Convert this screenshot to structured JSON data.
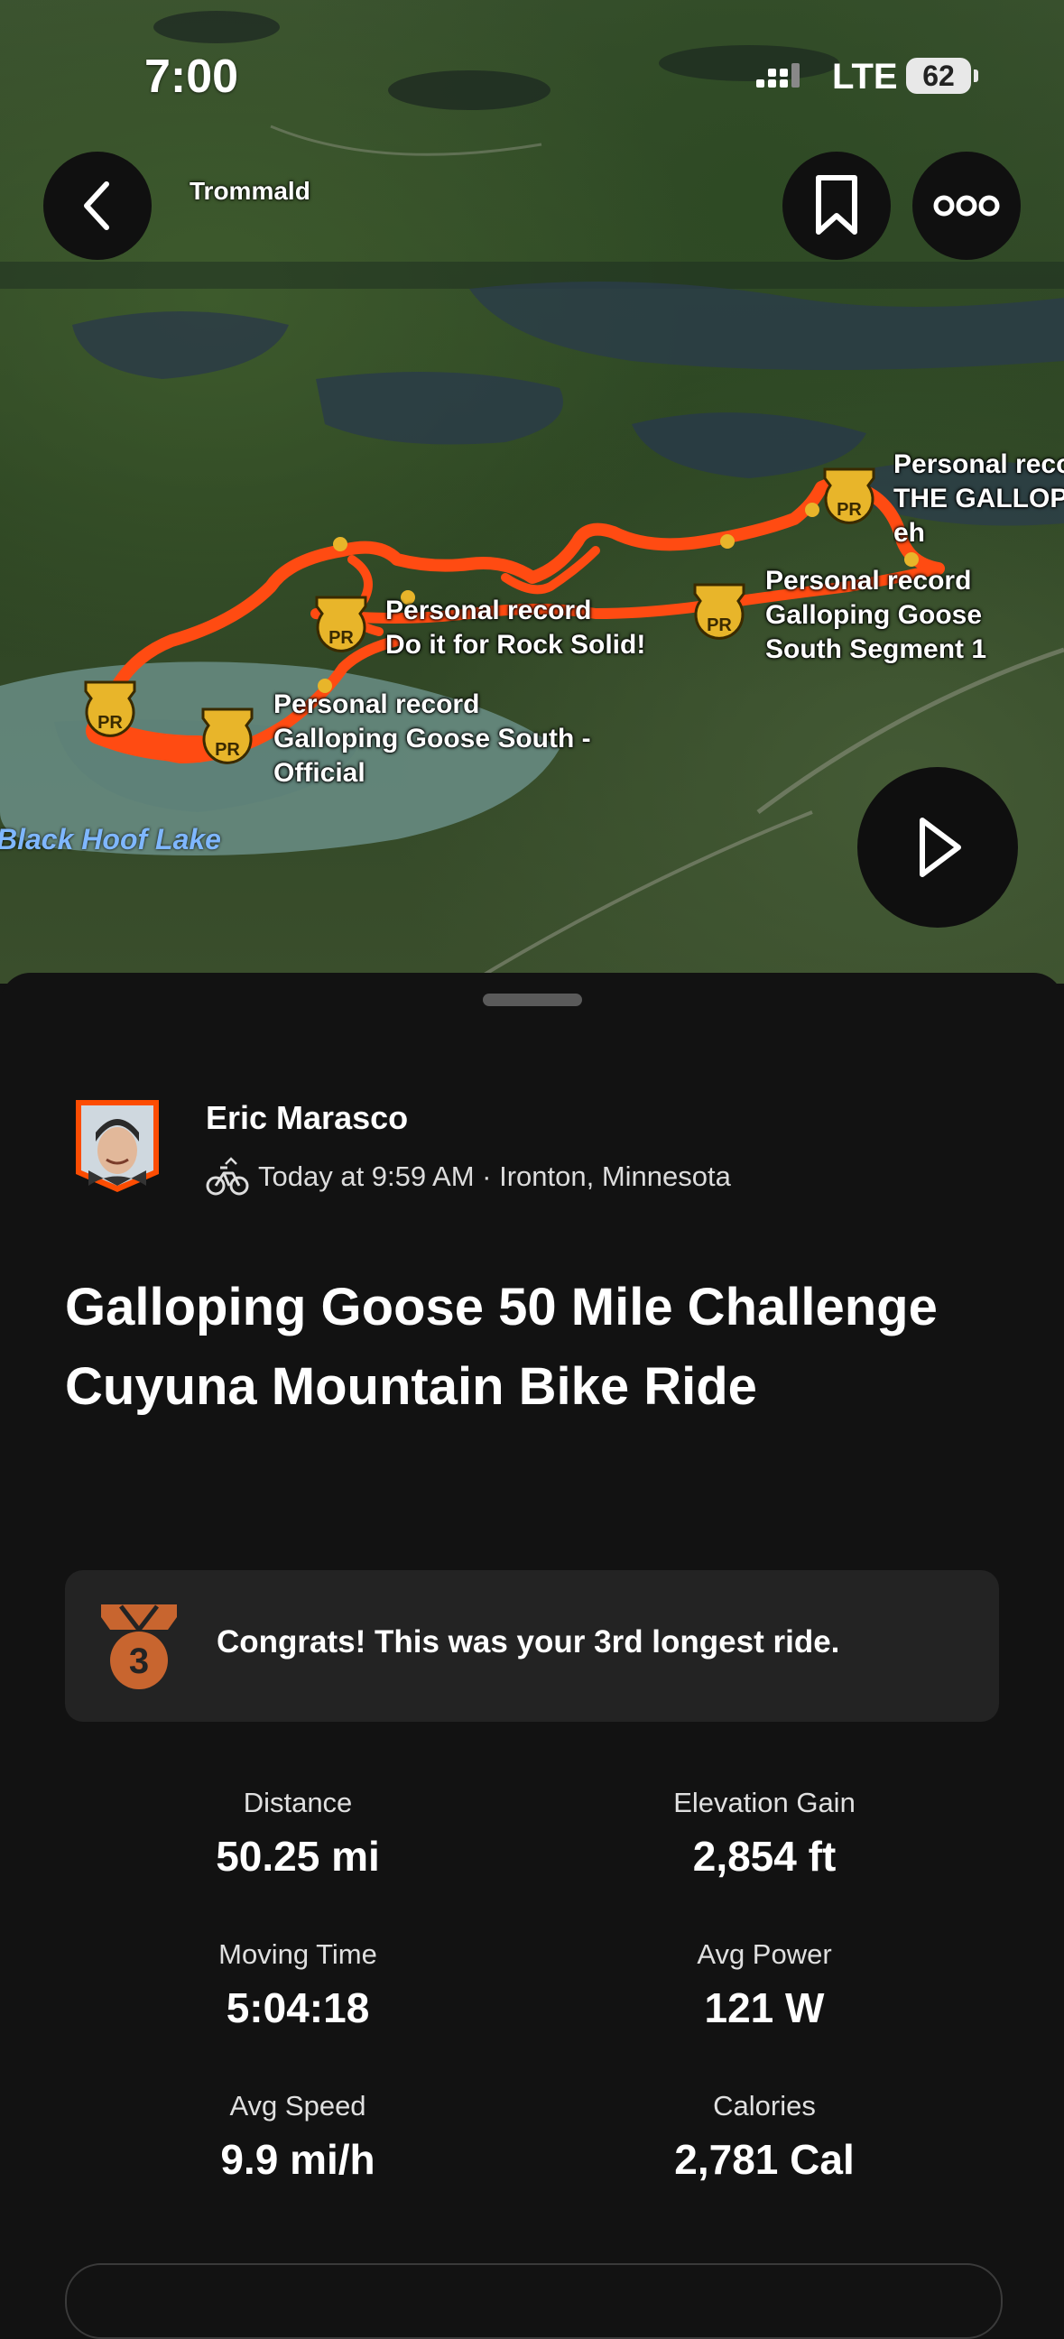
{
  "status_bar": {
    "time": "7:00",
    "network": "LTE",
    "battery": "62"
  },
  "map": {
    "place_label": "Trommald",
    "lake_label": "Black Hoof Lake",
    "pr_markers": [
      {
        "title": "Personal record",
        "segment": "Do it for Rock Solid!"
      },
      {
        "title": "Personal record",
        "segment": "Galloping Goose South - Official"
      },
      {
        "title": "Personal record",
        "segment": "Galloping Goose South Segment 1"
      },
      {
        "title": "Personal reco",
        "segment": "THE GALLOP",
        "segment2": "eh"
      }
    ],
    "badge_text": "PR",
    "route_color": "#ff4b12"
  },
  "activity": {
    "athlete_name": "Eric Marasco",
    "meta": "Today at 9:59 AM · Ironton, Minnesota",
    "title": "Galloping Goose 50 Mile Challenge Cuyuna Mountain Bike Ride",
    "achievement": {
      "rank": "3",
      "text": "Congrats! This was your 3rd longest ride."
    },
    "stats": [
      {
        "label": "Distance",
        "value": "50.25 mi"
      },
      {
        "label": "Elevation Gain",
        "value": "2,854 ft"
      },
      {
        "label": "Moving Time",
        "value": "5:04:18"
      },
      {
        "label": "Avg Power",
        "value": "121 W"
      },
      {
        "label": "Avg Speed",
        "value": "9.9 mi/h"
      },
      {
        "label": "Calories",
        "value": "2,781 Cal"
      }
    ]
  },
  "colors": {
    "accent": "#fc4c02",
    "medal": "#c8652f",
    "badge": "#e8b52a"
  }
}
